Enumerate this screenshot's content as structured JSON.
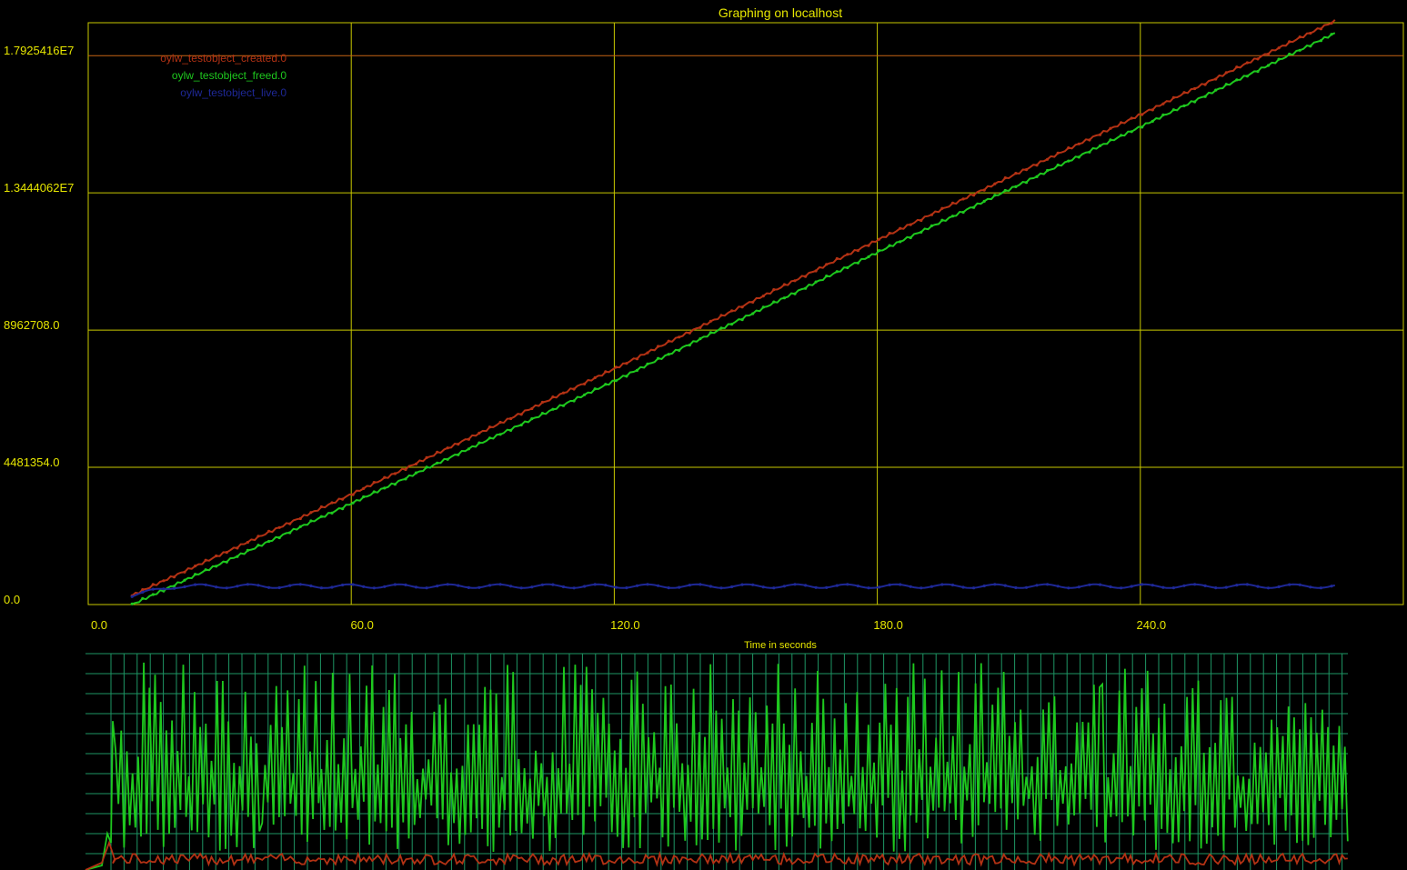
{
  "window": {
    "title": "Graphing on localhost"
  },
  "chart_data": [
    {
      "type": "line",
      "title": "Graphing on localhost",
      "xlabel": "Time in seconds",
      "ylabel": "",
      "xlim": [
        0,
        300
      ],
      "ylim": [
        0,
        19000000
      ],
      "x_ticks": [
        0,
        60,
        120,
        180,
        240
      ],
      "x_tick_labels": [
        "0.0",
        "60.0",
        "120.0",
        "180.0",
        "240.0"
      ],
      "y_ticks": [
        0,
        4481354,
        8962708,
        13444062,
        17925416
      ],
      "y_tick_labels": [
        "0.0",
        "4481354.0",
        "8962708.0",
        "1.3444062E7",
        "1.7925416E7"
      ],
      "grid": true,
      "legend": "top-left",
      "background": "#000000",
      "grid_color": "#c8c800",
      "text_color": "#e6e600",
      "series": [
        {
          "name": "oylw_testobject_created.0",
          "color": "#b43214",
          "x": [
            10,
            60,
            120,
            180,
            240,
            285
          ],
          "values": [
            300000,
            3600000,
            7700000,
            11900000,
            16000000,
            19100000
          ]
        },
        {
          "name": "oylw_testobject_freed.0",
          "color": "#1ec81e",
          "x": [
            10,
            60,
            120,
            180,
            240,
            285
          ],
          "values": [
            0,
            3300000,
            7300000,
            11500000,
            15600000,
            18700000
          ]
        },
        {
          "name": "oylw_testobject_live.0",
          "color": "#1e2896",
          "x": [
            10,
            20,
            60,
            120,
            180,
            240,
            285
          ],
          "values": [
            300000,
            600000,
            600000,
            600000,
            600000,
            600000,
            600000
          ]
        }
      ]
    },
    {
      "type": "line",
      "title": "",
      "xlabel": "",
      "grid": true,
      "grid_color": "#1e9664",
      "series": [
        {
          "color": "#1ec81e",
          "description": "rate of created objects, oscillating"
        },
        {
          "color": "#b43214",
          "description": "rate of live objects, low"
        }
      ]
    }
  ]
}
